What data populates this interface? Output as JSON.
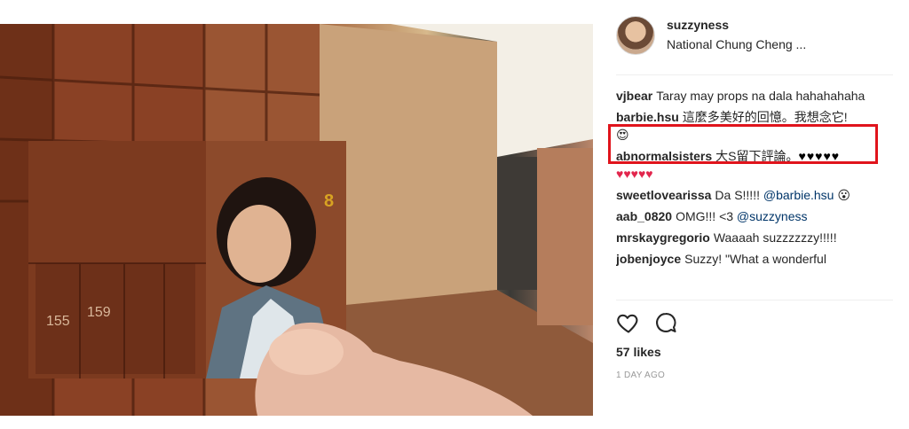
{
  "post": {
    "username": "suzzyness",
    "location": "National Chung Cheng ...",
    "likes": "57 likes",
    "time": "1 DAY AGO"
  },
  "photo_labels": {
    "locker_a": "155",
    "locker_b": "159",
    "badge": "8"
  },
  "comments": [
    {
      "user": "vjbear",
      "text": "Taray may props na dala hahahahaha"
    },
    {
      "user": "barbie.hsu",
      "text": "這麼多美好的回憶。我想念它!",
      "emoji": "😍"
    },
    {
      "user": "abnormalsisters",
      "text": "大S留下評論。",
      "hearts_black": "♥♥♥♥♥",
      "hearts_red": "♥♥♥♥♥"
    },
    {
      "user": "sweetlovearissa",
      "text": "Da S!!!!!",
      "mention": "@barbie.hsu",
      "emoji": "😮"
    },
    {
      "user": "aab_0820",
      "text": "OMG!!! <3",
      "mention": "@suzzyness"
    },
    {
      "user": "mrskaygregorio",
      "text": "Waaaah suzzzzzzy!!!!!"
    },
    {
      "user": "jobenjoyce",
      "text": "Suzzy! \"What a wonderful"
    }
  ],
  "colors": {
    "highlight": "#e0141c",
    "mention": "#003569",
    "meta_gray": "#999999"
  },
  "icons": {
    "like": "heart-outline-icon",
    "comment": "speech-bubble-icon"
  }
}
